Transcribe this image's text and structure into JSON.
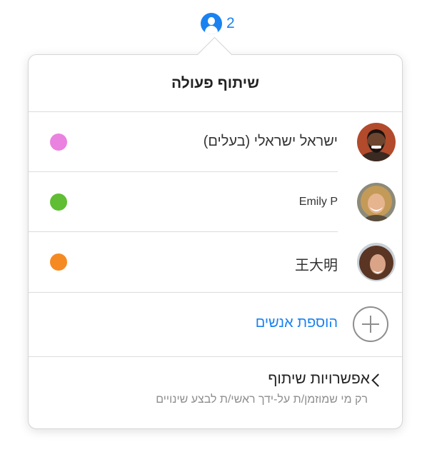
{
  "indicator": {
    "icon": "person-circle-icon",
    "count": "2"
  },
  "popover": {
    "title": "שיתוף פעולה",
    "participants": [
      {
        "name": "ישראל ישראלי (בעלים)",
        "dot_color": "#ea82e0",
        "avatar": "avatar-man-beard"
      },
      {
        "name": "Emily P",
        "dot_color": "#5fbe34",
        "avatar": "avatar-woman-curly"
      },
      {
        "name": "王大明",
        "dot_color": "#f68a22",
        "avatar": "avatar-woman-curly-dark"
      }
    ],
    "add_people": {
      "label": "הוספת אנשים",
      "icon": "plus-circle-icon"
    },
    "share_options": {
      "label": "אפשרויות שיתוף",
      "sublabel": "רק מי שמוזמן/ת על-ידך ראשי/ת לבצע שינויים"
    }
  },
  "colors": {
    "accent": "#1a82f0"
  }
}
